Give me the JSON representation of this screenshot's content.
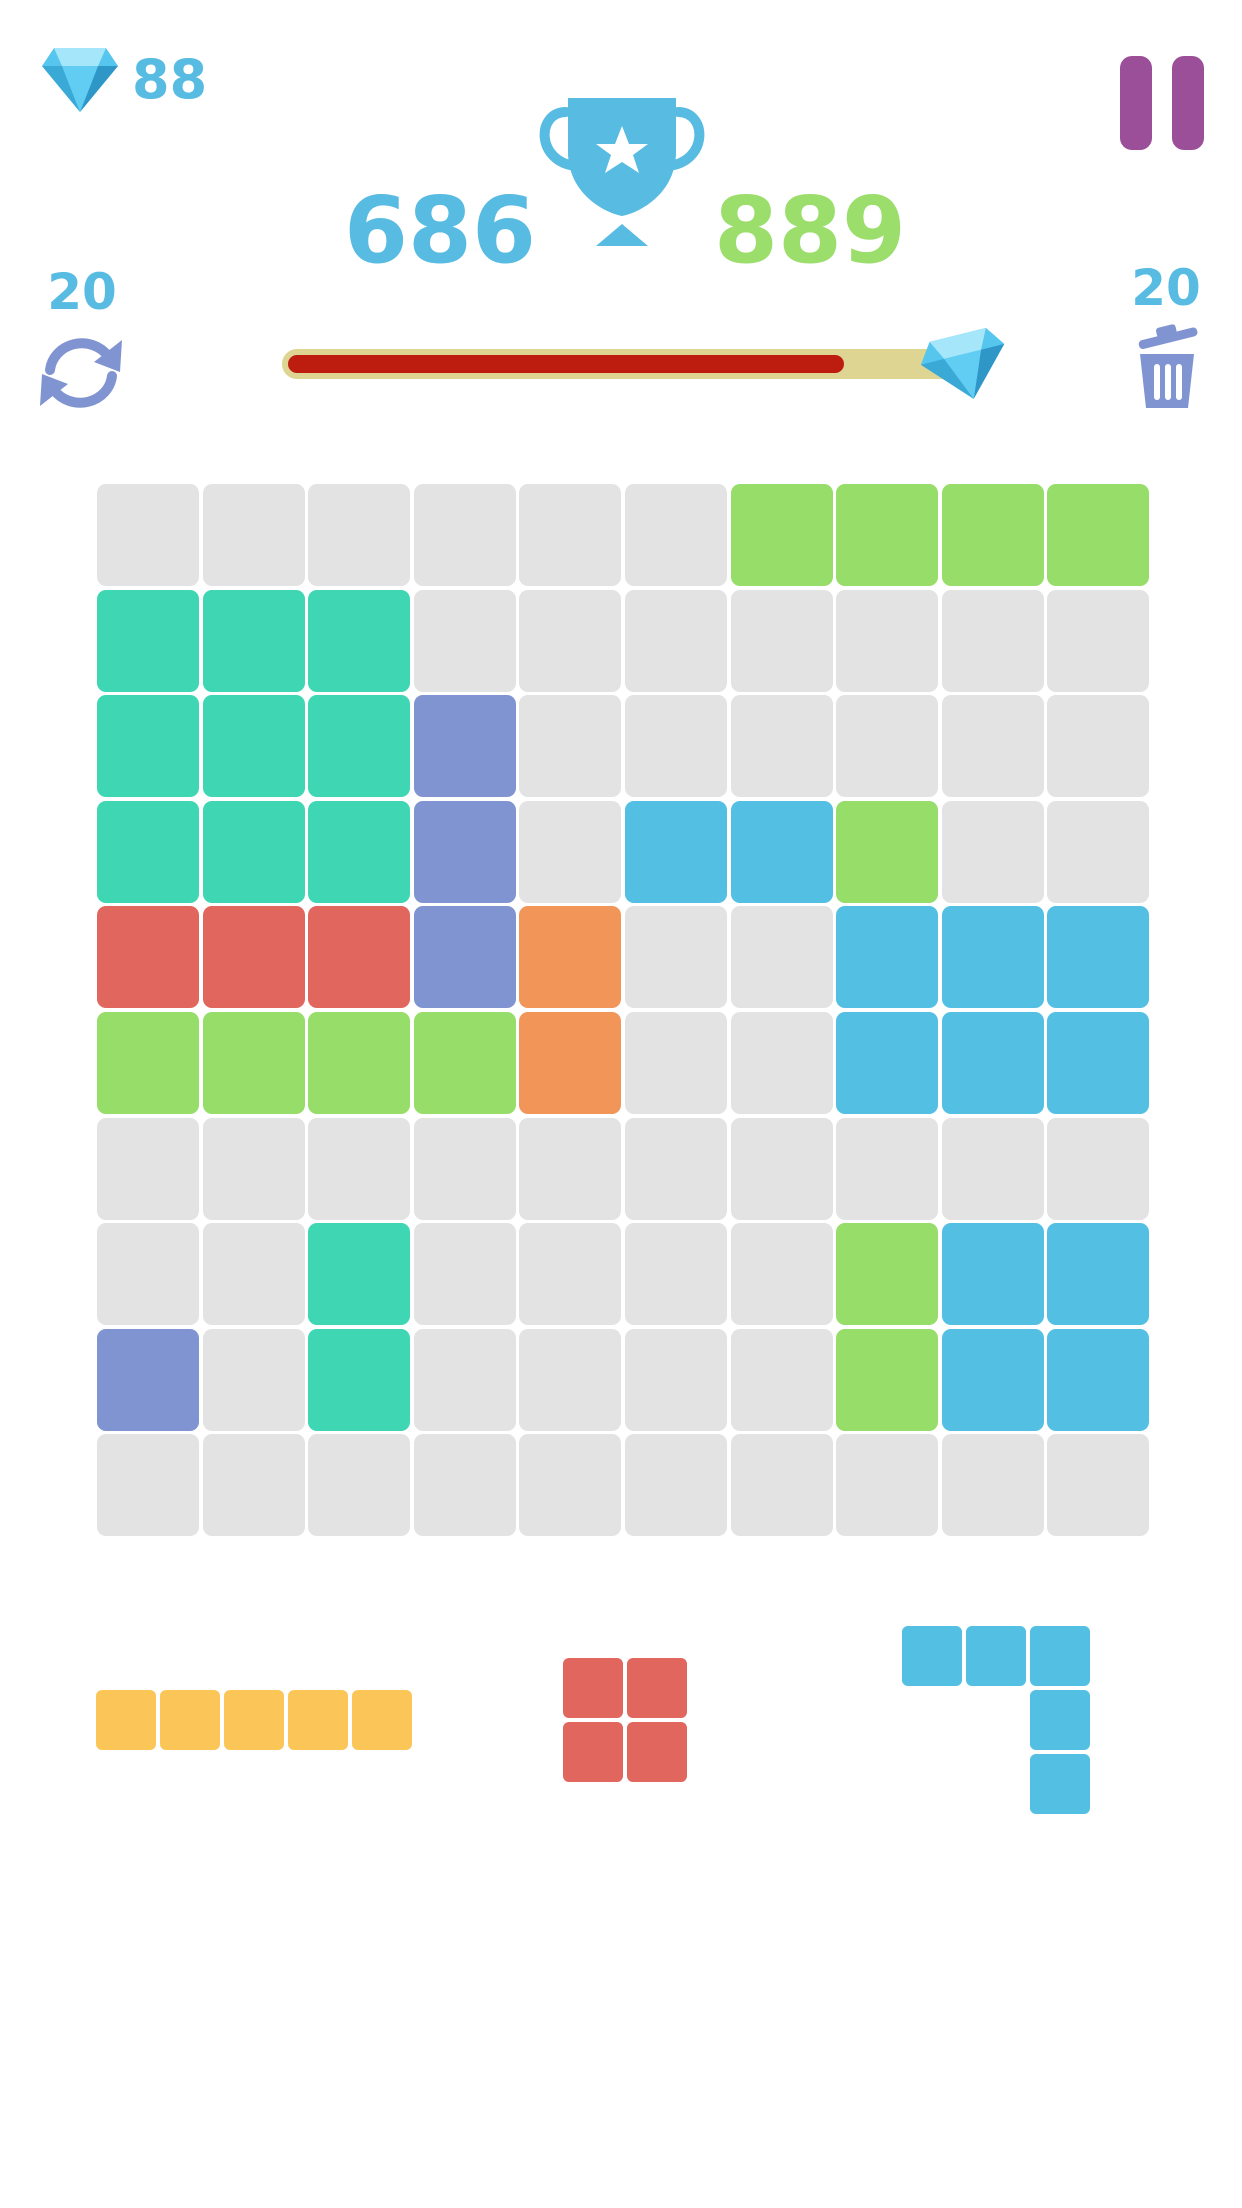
{
  "header": {
    "gems": "88",
    "current_score": "686",
    "best_score": "889",
    "progress": 0.82
  },
  "tools": {
    "refresh_count": "20",
    "trash_count": "20"
  },
  "colors": {
    "E": "#e3e3e3",
    "G": "#96dd69",
    "T": "#3ed6b3",
    "P": "#8094d1",
    "B": "#53bfe2",
    "R": "#e0665e",
    "O": "#f19559",
    "Y": "#fcc558",
    "accent_blue": "#58bbe2",
    "accent_green": "#9bde6c",
    "pause_purple": "#9a4f98",
    "progress_red": "#bd1d0e"
  },
  "board": [
    "EEEEEEGGGG",
    "TTTEEEEEEE",
    "TTTPEEEEEE",
    "TTTPEBBGEE",
    "RRRPOEEBBB",
    "GGGGOEEBBB",
    "EEEEEEEEEE",
    "EETEEEEGBB",
    "PETEEEEGBB",
    "EEEEEEEEEE"
  ],
  "pieces": [
    {
      "name": "piece-yellow-line",
      "color": "Y",
      "cells": [
        [
          0,
          0
        ],
        [
          0,
          1
        ],
        [
          0,
          2
        ],
        [
          0,
          3
        ],
        [
          0,
          4
        ]
      ]
    },
    {
      "name": "piece-red-square",
      "color": "R",
      "cells": [
        [
          0,
          0
        ],
        [
          0,
          1
        ],
        [
          1,
          0
        ],
        [
          1,
          1
        ]
      ]
    },
    {
      "name": "piece-blue-corner",
      "color": "B",
      "cells": [
        [
          0,
          0
        ],
        [
          0,
          1
        ],
        [
          0,
          2
        ],
        [
          1,
          2
        ],
        [
          2,
          2
        ]
      ]
    }
  ]
}
